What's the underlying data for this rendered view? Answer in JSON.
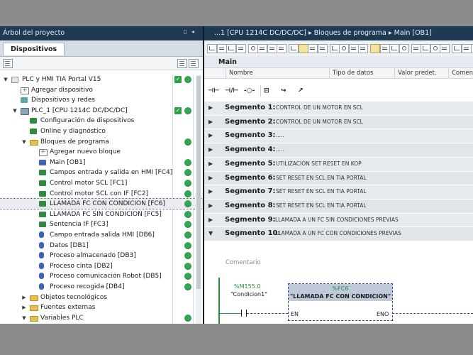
{
  "header": {
    "left_title": "Árbol del proyecto",
    "left_controls": "▯ ◂",
    "breadcrumb": "...1 [CPU 1214C DC/DC/DC]  ▸  Bloques de programa  ▸  Main [OB1]"
  },
  "left": {
    "tab_label": "Dispositivos",
    "tree": [
      {
        "label": "PLC y HMI TIA Portal V15",
        "arrow": "▼",
        "icon": "doc",
        "indent": 0,
        "check": true,
        "dot": true,
        "selected": false
      },
      {
        "label": "Agregar dispositivo",
        "arrow": "",
        "icon": "add",
        "indent": 1,
        "check": false,
        "dot": false,
        "selected": false
      },
      {
        "label": "Dispositivos y redes",
        "arrow": "",
        "icon": "net",
        "indent": 1,
        "check": false,
        "dot": false,
        "selected": false
      },
      {
        "label": "PLC_1 [CPU 1214C DC/DC/DC]",
        "arrow": "▼",
        "icon": "cpu",
        "indent": 1,
        "check": true,
        "dot": true,
        "selected": false
      },
      {
        "label": "Configuración de dispositivos",
        "arrow": "",
        "icon": "green",
        "indent": 2,
        "check": false,
        "dot": false,
        "selected": false
      },
      {
        "label": "Online y diagnóstico",
        "arrow": "",
        "icon": "green",
        "indent": 2,
        "check": false,
        "dot": false,
        "selected": false
      },
      {
        "label": "Bloques de programa",
        "arrow": "▼",
        "icon": "folder",
        "indent": 2,
        "check": false,
        "dot": true,
        "selected": false
      },
      {
        "label": "Agregar nuevo bloque",
        "arrow": "",
        "icon": "add",
        "indent": 3,
        "check": false,
        "dot": false,
        "selected": false
      },
      {
        "label": "Main [OB1]",
        "arrow": "",
        "icon": "blue",
        "indent": 3,
        "check": false,
        "dot": true,
        "selected": false
      },
      {
        "label": "Campos entrada y salida en HMI [FC4]",
        "arrow": "",
        "icon": "green",
        "indent": 3,
        "check": false,
        "dot": true,
        "selected": false
      },
      {
        "label": "Control motor SCL [FC1]",
        "arrow": "",
        "icon": "green",
        "indent": 3,
        "check": false,
        "dot": true,
        "selected": false
      },
      {
        "label": "Control motor SCL con IF [FC2]",
        "arrow": "",
        "icon": "green",
        "indent": 3,
        "check": false,
        "dot": true,
        "selected": false
      },
      {
        "label": "LLAMADA FC CON CONDICION [FC6]",
        "arrow": "",
        "icon": "green",
        "indent": 3,
        "check": false,
        "dot": true,
        "selected": true
      },
      {
        "label": "LLAMADA FC SIN CONDICION [FC5]",
        "arrow": "",
        "icon": "green",
        "indent": 3,
        "check": false,
        "dot": true,
        "selected": false
      },
      {
        "label": "Sentencia IF [FC3]",
        "arrow": "",
        "icon": "green",
        "indent": 3,
        "check": false,
        "dot": true,
        "selected": false
      },
      {
        "label": "Campo entrada salida HMI [DB6]",
        "arrow": "",
        "icon": "db",
        "indent": 3,
        "check": false,
        "dot": true,
        "selected": false
      },
      {
        "label": "Datos [DB1]",
        "arrow": "",
        "icon": "db",
        "indent": 3,
        "check": false,
        "dot": true,
        "selected": false
      },
      {
        "label": "Proceso almacenado [DB3]",
        "arrow": "",
        "icon": "db",
        "indent": 3,
        "check": false,
        "dot": true,
        "selected": false
      },
      {
        "label": "Proceso cinta [DB2]",
        "arrow": "",
        "icon": "db",
        "indent": 3,
        "check": false,
        "dot": true,
        "selected": false
      },
      {
        "label": "Proceso comunicación Robot [DB5]",
        "arrow": "",
        "icon": "db",
        "indent": 3,
        "check": false,
        "dot": true,
        "selected": false
      },
      {
        "label": "Proceso recogida [DB4]",
        "arrow": "",
        "icon": "db",
        "indent": 3,
        "check": false,
        "dot": true,
        "selected": false
      },
      {
        "label": "Objetos tecnológicos",
        "arrow": "▶",
        "icon": "folder",
        "indent": 2,
        "check": false,
        "dot": false,
        "selected": false
      },
      {
        "label": "Fuentes externas",
        "arrow": "▶",
        "icon": "folder",
        "indent": 2,
        "check": false,
        "dot": false,
        "selected": false
      },
      {
        "label": "Variables PLC",
        "arrow": "▼",
        "icon": "folder",
        "indent": 2,
        "check": false,
        "dot": true,
        "selected": false
      }
    ]
  },
  "right": {
    "block_title": "Main",
    "columns": [
      "Nombre",
      "Tipo de datos",
      "Valor predet.",
      "Coment"
    ],
    "ladder_tools": [
      "⊣⊢",
      "⊣/⊢",
      "-○-",
      "⊟",
      "↪",
      "↗"
    ],
    "segments": [
      {
        "arrow": "▶",
        "label": "Segmento 1:",
        "comment": "CONTROL DE UN MOTOR EN SCL"
      },
      {
        "arrow": "▶",
        "label": "Segmento 2:",
        "comment": "CONTROL DE UN MOTOR EN SCL"
      },
      {
        "arrow": "▶",
        "label": "Segmento 3:",
        "comment": "....."
      },
      {
        "arrow": "▶",
        "label": "Segmento 4:",
        "comment": "....."
      },
      {
        "arrow": "▶",
        "label": "Segmento 5:",
        "comment": "UTILIZACIÓN SET RESET EN    KOP"
      },
      {
        "arrow": "▶",
        "label": "Segmento 6:",
        "comment": "SET RESET EN SCL EN TIA PORTAL"
      },
      {
        "arrow": "▶",
        "label": "Segmento 7:",
        "comment": "SET RESET EN SCL EN TIA PORTAL"
      },
      {
        "arrow": "▶",
        "label": "Segmento 8:",
        "comment": "SET RESET EN SCL EN TIA PORTAL"
      },
      {
        "arrow": "▶",
        "label": "Segmento 9:",
        "comment": "LLAMADA A UN FC SIN CONDICIONES PREVIAS"
      },
      {
        "arrow": "▼",
        "label": "Segmento 10:",
        "comment": "LLAMADA A UN FC CON CONDICIONES PREVIAS"
      }
    ],
    "comment_placeholder": "Comentario",
    "network": {
      "operand_address": "%M155.0",
      "operand_name": "\"Condicion1\"",
      "fc_number": "%FC6",
      "fc_title": "\"LLAMADA FC CON CONDICION\"",
      "pin_en": "EN",
      "pin_eno": "ENO"
    }
  }
}
